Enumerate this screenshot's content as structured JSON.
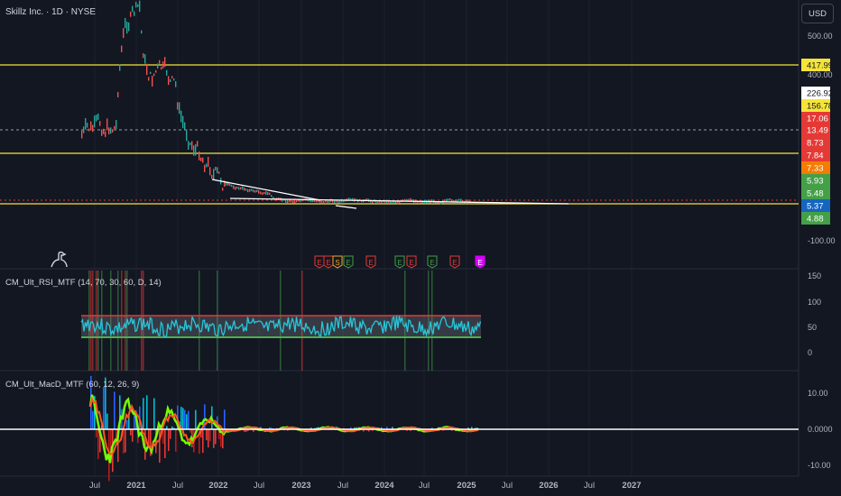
{
  "header": {
    "title": "Skillz Inc. · 1D · NYSE",
    "currency": "USD"
  },
  "indicators": {
    "rsi_label": "CM_Ult_RSI_MTF (14, 70, 30, 60, D, 14)",
    "macd_label": "CM_Ult_MacD_MTF (60, 12, 26, 9)"
  },
  "colors": {
    "background": "#131722",
    "grid": "#1e222d",
    "price_line_yellow": "#f5e43a",
    "rsi_line": "#26c6da",
    "rsi_band_red": "#e53935",
    "rsi_band_green": "#4caf50",
    "macd_zero": "#ffffff",
    "candle_up": "#26a69a",
    "candle_down": "#ef5350"
  },
  "chart_data": [
    {
      "type": "line",
      "panel": "price",
      "x_ticks": [
        "Jul",
        "2021",
        "Jul",
        "2022",
        "Jul",
        "2023",
        "Jul",
        "2024",
        "Jul",
        "2025",
        "Jul",
        "2026",
        "Jul",
        "2027"
      ],
      "y_ticks": [
        "500.00",
        "400.00",
        "-100.00"
      ],
      "horizontal_lines": [
        417.99,
        156.78,
        5.93
      ],
      "price_labels": [
        {
          "value": "417.99",
          "color": "#f5e43a"
        },
        {
          "value": "226.92",
          "color": "#ffffff"
        },
        {
          "value": "156.78",
          "color": "#f5e43a"
        },
        {
          "value": "17.06",
          "color": "#e53935"
        },
        {
          "value": "13.49",
          "color": "#e53935"
        },
        {
          "value": "8.73",
          "color": "#e53935"
        },
        {
          "value": "7.84",
          "color": "#e53935"
        },
        {
          "value": "7.33",
          "color": "#f57c00"
        },
        {
          "value": "5.93",
          "color": "#43a047"
        },
        {
          "value": "5.48",
          "color": "#43a047"
        },
        {
          "value": "5.37",
          "color": "#1565c0"
        },
        {
          "value": "4.88",
          "color": "#43a047"
        }
      ],
      "earnings_markers": [
        {
          "label": "E",
          "color": "#e53935"
        },
        {
          "label": "E",
          "color": "#e53935"
        },
        {
          "label": "S",
          "color": "#f5a623"
        },
        {
          "label": "E",
          "color": "#43a047"
        },
        {
          "label": "E",
          "color": "#e53935"
        },
        {
          "label": "E",
          "color": "#43a047"
        },
        {
          "label": "E",
          "color": "#e53935"
        },
        {
          "label": "E",
          "color": "#43a047"
        },
        {
          "label": "E",
          "color": "#e53935"
        },
        {
          "label": "E",
          "color": "#d500f9"
        }
      ]
    },
    {
      "type": "line",
      "panel": "rsi",
      "y_ticks": [
        "150",
        "100",
        "50",
        "0"
      ],
      "upper_band": 70,
      "lower_band": 30,
      "mid": 50
    },
    {
      "type": "bar",
      "panel": "macd",
      "y_ticks": [
        "10.00",
        "0.0000",
        "-10.00"
      ],
      "zero_line": 0
    }
  ]
}
